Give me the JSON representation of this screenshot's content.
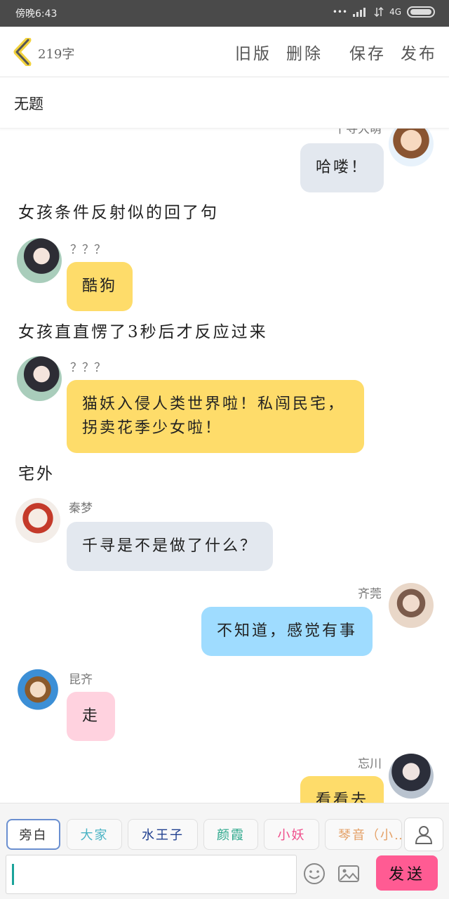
{
  "status": {
    "time": "傍晚6:43",
    "signal": "4G"
  },
  "toolbar": {
    "word_count": "219字",
    "old_version": "旧版",
    "delete": "删除",
    "save": "保存",
    "publish": "发布"
  },
  "doc": {
    "title": "无题"
  },
  "messages": [
    {
      "speaker": "千寻大萌",
      "text": "哈喽！"
    },
    {
      "narration": "女孩条件反射似的回了句"
    },
    {
      "speaker": "？？？",
      "text": "酷狗"
    },
    {
      "narration": "女孩直直愣了3秒后才反应过来"
    },
    {
      "speaker": "？？？",
      "text": "猫妖入侵人类世界啦！私闯民宅，拐卖花季少女啦！"
    },
    {
      "narration": "宅外"
    },
    {
      "speaker": "秦梦",
      "text": "千寻是不是做了什么？"
    },
    {
      "speaker": "齐莞",
      "text": "不知道，感觉有事"
    },
    {
      "speaker": "昆齐",
      "text": "走"
    },
    {
      "speaker": "忘川",
      "text": "看看去"
    }
  ],
  "roles": [
    {
      "label": "旁白",
      "color": "#333333"
    },
    {
      "label": "大家",
      "color": "#4ab3c4"
    },
    {
      "label": "水王子",
      "color": "#1f3f8f"
    },
    {
      "label": "颜霞",
      "color": "#29a68a"
    },
    {
      "label": "小妖",
      "color": "#ef4d8a"
    },
    {
      "label": "琴音（小…",
      "color": "#e4a066"
    }
  ],
  "composer": {
    "text": "",
    "send_label": "发送"
  },
  "colors": {
    "bubble_gray": "#e3e8ef",
    "bubble_yellow": "#fedc6a",
    "bubble_blue": "#9fdcff",
    "bubble_pink": "#ffd2df",
    "send": "#ff5b93"
  }
}
